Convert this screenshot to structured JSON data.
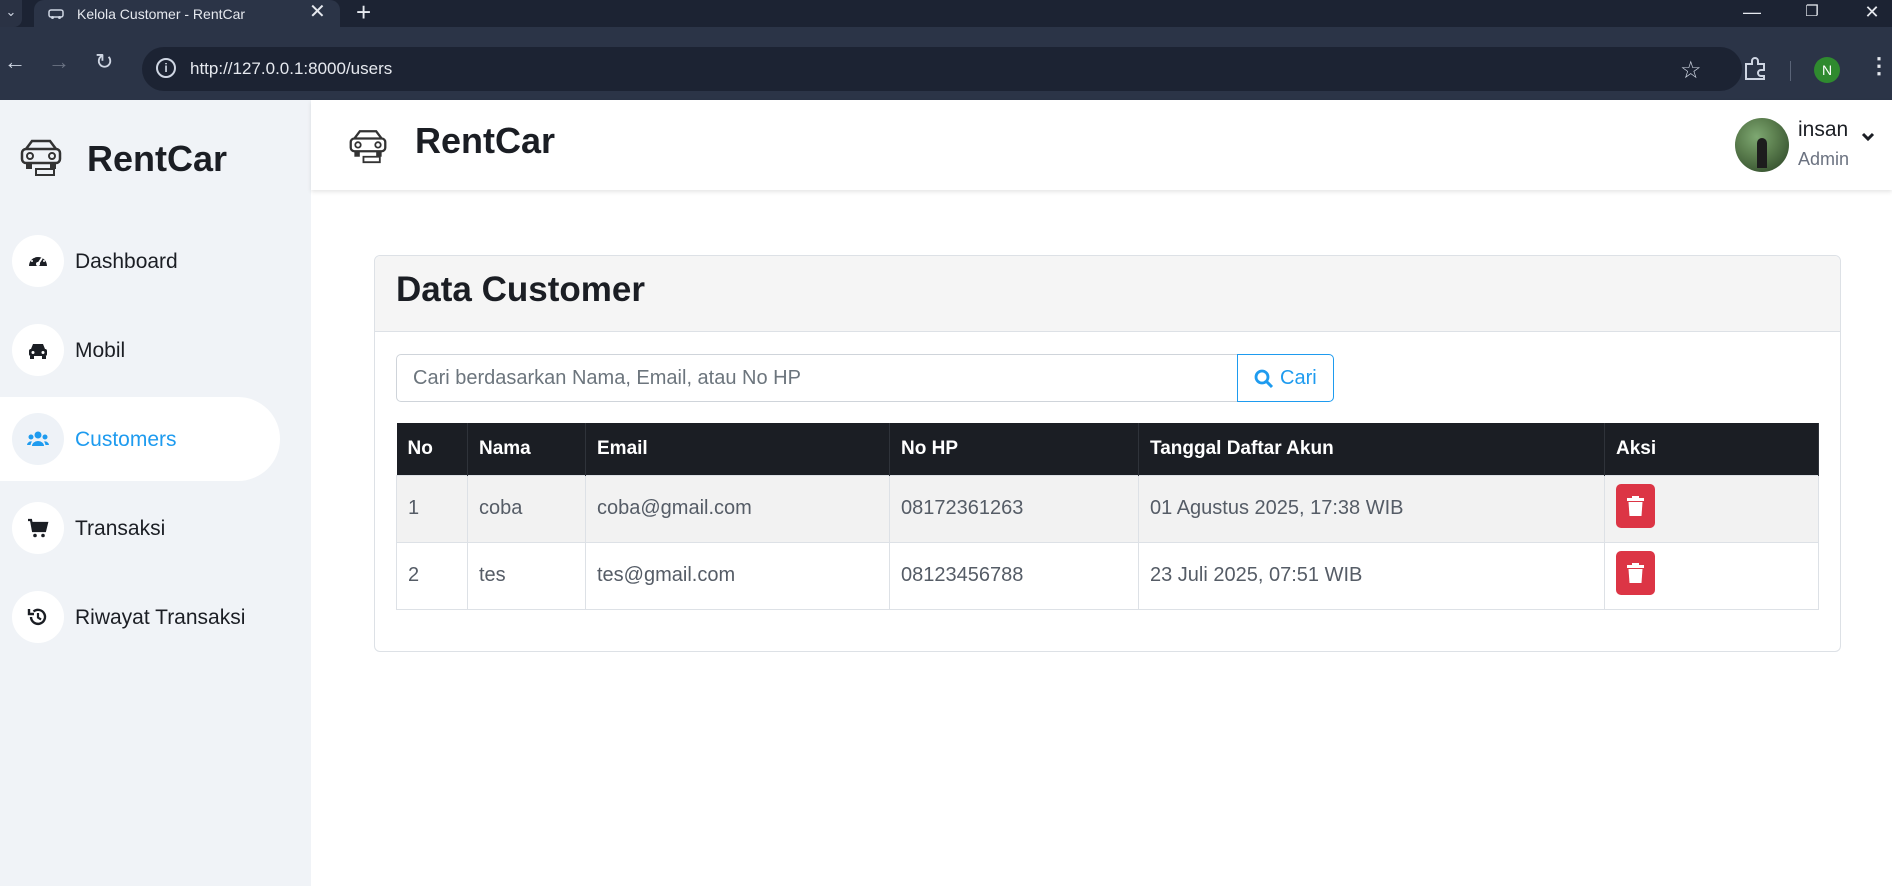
{
  "browser": {
    "tab_title": "Kelola Customer - RentCar",
    "url": "http://127.0.0.1:8000/users",
    "profile_initial": "N"
  },
  "sidebar": {
    "brand": "RentCar",
    "items": [
      {
        "label": "Dashboard",
        "icon": "gauge-icon"
      },
      {
        "label": "Mobil",
        "icon": "car-icon"
      },
      {
        "label": "Customers",
        "icon": "users-icon",
        "active": true
      },
      {
        "label": "Transaksi",
        "icon": "cart-icon"
      },
      {
        "label": "Riwayat Transaksi",
        "icon": "history-icon"
      }
    ]
  },
  "header": {
    "brand": "RentCar",
    "user_name": "insan",
    "user_role": "Admin"
  },
  "main": {
    "title": "Data Customer",
    "search_placeholder": "Cari berdasarkan Nama, Email, atau No HP",
    "search_button": "Cari",
    "columns": [
      "No",
      "Nama",
      "Email",
      "No HP",
      "Tanggal Daftar Akun",
      "Aksi"
    ],
    "rows": [
      {
        "no": "1",
        "nama": "coba",
        "email": "coba@gmail.com",
        "hp": "08172361263",
        "tanggal": "01 Agustus 2025, 17:38 WIB"
      },
      {
        "no": "2",
        "nama": "tes",
        "email": "tes@gmail.com",
        "hp": "08123456788",
        "tanggal": "23 Juli 2025, 07:51 WIB"
      }
    ]
  },
  "colors": {
    "accent": "#1e9bef",
    "danger": "#dc3545",
    "table_header": "#1b1e24",
    "sidebar_bg": "#f0f3f7"
  }
}
